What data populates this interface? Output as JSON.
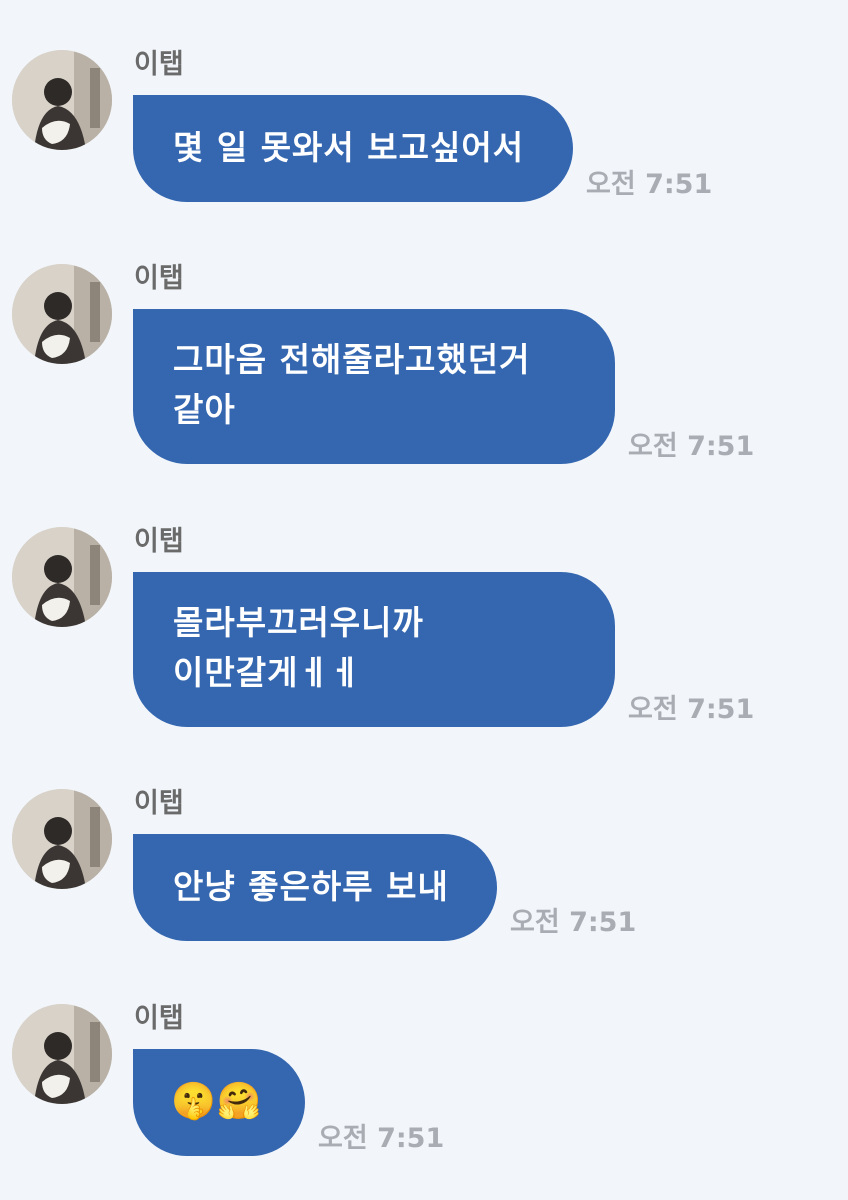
{
  "colors": {
    "background": "#f2f6fb",
    "bubble": "#3567b0",
    "bubble_text": "#ffffff",
    "sender": "#6a6a6a",
    "time": "#a9adb3"
  },
  "messages": [
    {
      "sender": "이탭",
      "text": "몇 일 못와서 보고싶어서",
      "time": "오전 7:51"
    },
    {
      "sender": "이탭",
      "text": "그마음 전해줄라고했던거\n같아",
      "time": "오전 7:51"
    },
    {
      "sender": "이탭",
      "text": "몰라부끄러우니까\n이만갈게ㅔㅔ",
      "time": "오전 7:51"
    },
    {
      "sender": "이탭",
      "text": "안냥 좋은하루 보내",
      "time": "오전 7:51"
    },
    {
      "sender": "이탭",
      "text": "🤫🤗",
      "time": "오전 7:51"
    }
  ]
}
